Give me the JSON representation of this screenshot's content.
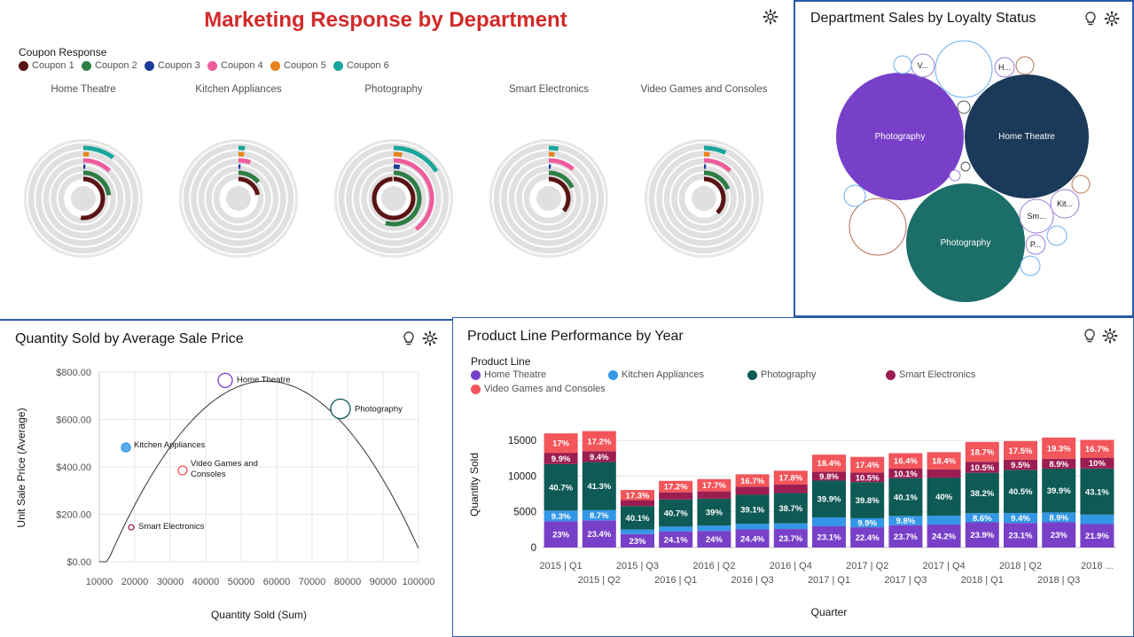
{
  "colors": {
    "coupon_1": "#5a1414",
    "coupon_2": "#2e7d45",
    "coupon_3": "#1c3c9a",
    "coupon_4": "#ee5c9c",
    "coupon_5": "#e8821a",
    "coupon_6": "#1aa59a",
    "home_theatre": "#7840c8",
    "kitchen_appliances": "#3397e6",
    "photography": "#0e5a55",
    "smart_electronics": "#9c1d52",
    "video_games": "#f2555a",
    "frame_blue": "#2c5aa8",
    "title_red": "#d12a2a"
  },
  "panel_marketing": {
    "title": "Marketing Response by Department",
    "legend_title": "Coupon Response",
    "legend": [
      "Coupon 1",
      "Coupon 2",
      "Coupon 3",
      "Coupon 4",
      "Coupon 5",
      "Coupon 6"
    ],
    "icons": [
      "settings-icon"
    ],
    "chart_data": {
      "type": "radial-bar",
      "series": [
        "Coupon 1",
        "Coupon 2",
        "Coupon 3",
        "Coupon 4",
        "Coupon 5",
        "Coupon 6"
      ],
      "departments": [
        {
          "name": "Home Theatre",
          "fractions": [
            0.52,
            0.23,
            0.01,
            0.12,
            0.02,
            0.1
          ]
        },
        {
          "name": "Kitchen Appliances",
          "fractions": [
            0.22,
            0.14,
            0.01,
            0.05,
            0.02,
            0.02
          ]
        },
        {
          "name": "Photography",
          "fractions": [
            0.99,
            0.55,
            0.03,
            0.4,
            0.03,
            0.16
          ]
        },
        {
          "name": "Smart Electronics",
          "fractions": [
            0.36,
            0.18,
            0.01,
            0.11,
            0.02,
            0.03
          ]
        },
        {
          "name": "Video Games and Consoles",
          "fractions": [
            0.38,
            0.19,
            0.01,
            0.12,
            0.02,
            0.07
          ]
        }
      ]
    }
  },
  "panel_loyalty": {
    "title": "Department Sales by Loyalty Status",
    "icons": [
      "lightbulb-icon",
      "settings-icon"
    ],
    "chart_data": {
      "type": "bubble",
      "bubbles": [
        {
          "label": "Photography",
          "size": 1.0,
          "fill": "#7840c8",
          "filled": true
        },
        {
          "label": "Home Theatre",
          "size": 0.95,
          "fill": "#1b3a5a",
          "filled": true
        },
        {
          "label": "Photography",
          "size": 0.93,
          "fill": "#1c6e69",
          "filled": true
        },
        {
          "label": "V...",
          "size": 0.16,
          "fill": "#9a7cd8",
          "filled": false
        },
        {
          "label": "H...",
          "size": 0.12,
          "fill": "#9a7cd8",
          "filled": false
        },
        {
          "label": "Sm...",
          "size": 0.19,
          "fill": "#9a7cd8",
          "filled": false
        },
        {
          "label": "Kit...",
          "size": 0.17,
          "fill": "#9a7cd8",
          "filled": false
        },
        {
          "label": "P...",
          "size": 0.12,
          "fill": "#9a7cd8",
          "filled": false
        },
        {
          "label": "",
          "size": 0.44,
          "fill": "#6aaef0",
          "filled": false
        },
        {
          "label": "",
          "size": 0.43,
          "fill": "#b07050",
          "filled": false
        }
      ]
    }
  },
  "panel_scatter": {
    "title": "Quantity Sold by Average Sale Price",
    "icons": [
      "lightbulb-icon",
      "settings-icon"
    ],
    "chart_data": {
      "type": "scatter",
      "xlabel": "Quantity Sold (Sum)",
      "ylabel": "Unit Sale Price (Average)",
      "xlim": [
        10000,
        100000
      ],
      "ylim": [
        0,
        800
      ],
      "x_ticks": [
        "10000",
        "20000",
        "30000",
        "40000",
        "50000",
        "60000",
        "70000",
        "80000",
        "90000",
        "100000"
      ],
      "y_ticks": [
        "$0.00",
        "$200.00",
        "$400.00",
        "$600.00",
        "$800.00"
      ],
      "points": [
        {
          "label": "Home Theatre",
          "x": 45500,
          "y": 765,
          "size": 8,
          "color": "#7840c8",
          "filled": false
        },
        {
          "label": "Photography",
          "x": 78000,
          "y": 645,
          "size": 11,
          "color": "#0e5a55",
          "filled": false
        },
        {
          "label": "Kitchen Appliances",
          "x": 17500,
          "y": 482,
          "size": 5,
          "color": "#3397e6",
          "filled": true
        },
        {
          "label": "Video Games and Consoles",
          "x": 33500,
          "y": 385,
          "size": 5,
          "color": "#f2555a",
          "filled": false
        },
        {
          "label": "Smart Electronics",
          "x": 19000,
          "y": 145,
          "size": 3,
          "color": "#9c1d52",
          "filled": false
        }
      ],
      "trend": {
        "type": "quadratic",
        "a": -3.82e-07,
        "b": 0.04355,
        "c": -479
      }
    }
  },
  "panel_product": {
    "title": "Product Line Performance by Year",
    "legend_title": "Product Line",
    "legend": [
      "Home Theatre",
      "Kitchen Appliances",
      "Photography",
      "Smart Electronics",
      "Video Games and Consoles"
    ],
    "icons": [
      "lightbulb-icon",
      "settings-icon"
    ],
    "chart_data": {
      "type": "bar",
      "stacked": true,
      "xlabel": "Quarter",
      "ylabel": "Quantity Sold",
      "ylim": [
        0,
        16000
      ],
      "y_ticks": [
        "0",
        "5000",
        "10000",
        "15000"
      ],
      "categories": [
        "2015 | Q1",
        "2015 | Q2",
        "2015 | Q3",
        "2016 | Q1",
        "2016 | Q2",
        "2016 | Q3",
        "2016 | Q4",
        "2017 | Q1",
        "2017 | Q2",
        "2017 | Q3",
        "2017 | Q4",
        "2018 | Q1",
        "2018 | Q2",
        "2018 | Q3",
        "2018 ..."
      ],
      "x_ticks_row1": [
        "2015 | Q1",
        "2015 | Q3",
        "2016 | Q2",
        "2016 | Q4",
        "2017 | Q2",
        "2017 | Q4",
        "2018 | Q2",
        "2018 ..."
      ],
      "x_ticks_row2": [
        "2015 | Q2",
        "2016 | Q1",
        "2016 | Q3",
        "2017 | Q1",
        "2017 | Q3",
        "2018 | Q1",
        "2018 | Q3"
      ],
      "totals": [
        16000,
        16300,
        8200,
        9300,
        9700,
        10400,
        10900,
        12900,
        12700,
        13200,
        13300,
        14800,
        14900,
        15400,
        15000
      ],
      "series": [
        {
          "name": "Home Theatre",
          "values": [
            3680,
            3810,
            1890,
            2240,
            2330,
            2540,
            2590,
            2980,
            2840,
            3130,
            3220,
            3540,
            3440,
            3540,
            3290
          ],
          "labels": [
            "23%",
            "23.4%",
            "23%",
            "24.1%",
            "24%",
            "24.4%",
            "23.7%",
            "23.1%",
            "22.4%",
            "23.7%",
            "24.2%",
            "23.9%",
            "23.1%",
            "23%",
            "21.9%"
          ]
        },
        {
          "name": "Kitchen Appliances",
          "values": [
            1490,
            1420,
            630,
            700,
            730,
            780,
            810,
            1240,
            1260,
            1290,
            1250,
            1270,
            1400,
            1370,
            1320
          ],
          "labels": [
            "9.3%",
            "8.7%",
            "",
            "",
            "",
            "",
            "",
            "",
            "9.9%",
            "9.8%",
            "",
            "8.6%",
            "9.4%",
            "8.9%",
            ""
          ]
        },
        {
          "name": "Photography",
          "values": [
            6510,
            6730,
            3290,
            3790,
            3780,
            4070,
            4220,
            5150,
            5060,
            5290,
            5320,
            5650,
            6030,
            6140,
            6460
          ],
          "labels": [
            "40.7%",
            "41.3%",
            "40.1%",
            "40.7%",
            "39%",
            "39.1%",
            "38.7%",
            "39.9%",
            "39.8%",
            "40.1%",
            "40%",
            "38.2%",
            "40.5%",
            "39.9%",
            "43.1%"
          ]
        },
        {
          "name": "Smart Electronics",
          "values": [
            1580,
            1530,
            820,
            1000,
            1020,
            1120,
            1190,
            1260,
            1330,
            1330,
            1160,
            1550,
            1420,
            1370,
            1500
          ],
          "labels": [
            "9.9%",
            "9.4%",
            "",
            "",
            "",
            "",
            "",
            "9.8%",
            "10.5%",
            "10.1%",
            "",
            "10.5%",
            "9.5%",
            "8.9%",
            "10%"
          ]
        },
        {
          "name": "Video Games and Consoles",
          "values": [
            2720,
            2810,
            1420,
            1600,
            1720,
            1740,
            1940,
            2370,
            2200,
            2170,
            2400,
            2770,
            2610,
            2980,
            2500
          ],
          "labels": [
            "17%",
            "17.2%",
            "17.3%",
            "17.2%",
            "17.7%",
            "16.7%",
            "17.8%",
            "18.4%",
            "17.4%",
            "16.4%",
            "18.4%",
            "18.7%",
            "17.5%",
            "19.3%",
            "16.7%"
          ]
        }
      ]
    }
  }
}
